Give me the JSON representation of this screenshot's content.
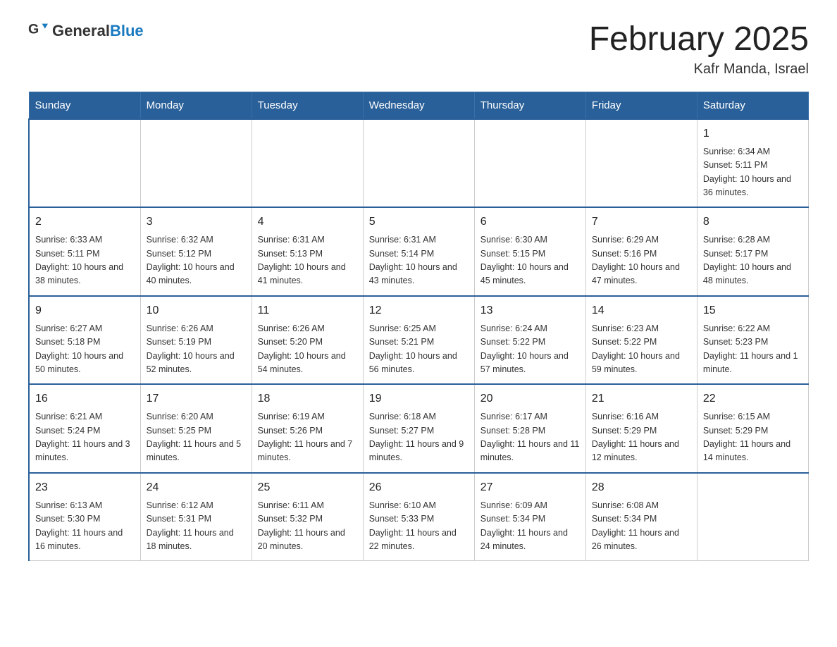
{
  "header": {
    "logo_general": "General",
    "logo_blue": "Blue",
    "month_title": "February 2025",
    "location": "Kafr Manda, Israel"
  },
  "days_of_week": [
    "Sunday",
    "Monday",
    "Tuesday",
    "Wednesday",
    "Thursday",
    "Friday",
    "Saturday"
  ],
  "weeks": [
    [
      {
        "day": "",
        "info": ""
      },
      {
        "day": "",
        "info": ""
      },
      {
        "day": "",
        "info": ""
      },
      {
        "day": "",
        "info": ""
      },
      {
        "day": "",
        "info": ""
      },
      {
        "day": "",
        "info": ""
      },
      {
        "day": "1",
        "info": "Sunrise: 6:34 AM\nSunset: 5:11 PM\nDaylight: 10 hours and 36 minutes."
      }
    ],
    [
      {
        "day": "2",
        "info": "Sunrise: 6:33 AM\nSunset: 5:11 PM\nDaylight: 10 hours and 38 minutes."
      },
      {
        "day": "3",
        "info": "Sunrise: 6:32 AM\nSunset: 5:12 PM\nDaylight: 10 hours and 40 minutes."
      },
      {
        "day": "4",
        "info": "Sunrise: 6:31 AM\nSunset: 5:13 PM\nDaylight: 10 hours and 41 minutes."
      },
      {
        "day": "5",
        "info": "Sunrise: 6:31 AM\nSunset: 5:14 PM\nDaylight: 10 hours and 43 minutes."
      },
      {
        "day": "6",
        "info": "Sunrise: 6:30 AM\nSunset: 5:15 PM\nDaylight: 10 hours and 45 minutes."
      },
      {
        "day": "7",
        "info": "Sunrise: 6:29 AM\nSunset: 5:16 PM\nDaylight: 10 hours and 47 minutes."
      },
      {
        "day": "8",
        "info": "Sunrise: 6:28 AM\nSunset: 5:17 PM\nDaylight: 10 hours and 48 minutes."
      }
    ],
    [
      {
        "day": "9",
        "info": "Sunrise: 6:27 AM\nSunset: 5:18 PM\nDaylight: 10 hours and 50 minutes."
      },
      {
        "day": "10",
        "info": "Sunrise: 6:26 AM\nSunset: 5:19 PM\nDaylight: 10 hours and 52 minutes."
      },
      {
        "day": "11",
        "info": "Sunrise: 6:26 AM\nSunset: 5:20 PM\nDaylight: 10 hours and 54 minutes."
      },
      {
        "day": "12",
        "info": "Sunrise: 6:25 AM\nSunset: 5:21 PM\nDaylight: 10 hours and 56 minutes."
      },
      {
        "day": "13",
        "info": "Sunrise: 6:24 AM\nSunset: 5:22 PM\nDaylight: 10 hours and 57 minutes."
      },
      {
        "day": "14",
        "info": "Sunrise: 6:23 AM\nSunset: 5:22 PM\nDaylight: 10 hours and 59 minutes."
      },
      {
        "day": "15",
        "info": "Sunrise: 6:22 AM\nSunset: 5:23 PM\nDaylight: 11 hours and 1 minute."
      }
    ],
    [
      {
        "day": "16",
        "info": "Sunrise: 6:21 AM\nSunset: 5:24 PM\nDaylight: 11 hours and 3 minutes."
      },
      {
        "day": "17",
        "info": "Sunrise: 6:20 AM\nSunset: 5:25 PM\nDaylight: 11 hours and 5 minutes."
      },
      {
        "day": "18",
        "info": "Sunrise: 6:19 AM\nSunset: 5:26 PM\nDaylight: 11 hours and 7 minutes."
      },
      {
        "day": "19",
        "info": "Sunrise: 6:18 AM\nSunset: 5:27 PM\nDaylight: 11 hours and 9 minutes."
      },
      {
        "day": "20",
        "info": "Sunrise: 6:17 AM\nSunset: 5:28 PM\nDaylight: 11 hours and 11 minutes."
      },
      {
        "day": "21",
        "info": "Sunrise: 6:16 AM\nSunset: 5:29 PM\nDaylight: 11 hours and 12 minutes."
      },
      {
        "day": "22",
        "info": "Sunrise: 6:15 AM\nSunset: 5:29 PM\nDaylight: 11 hours and 14 minutes."
      }
    ],
    [
      {
        "day": "23",
        "info": "Sunrise: 6:13 AM\nSunset: 5:30 PM\nDaylight: 11 hours and 16 minutes."
      },
      {
        "day": "24",
        "info": "Sunrise: 6:12 AM\nSunset: 5:31 PM\nDaylight: 11 hours and 18 minutes."
      },
      {
        "day": "25",
        "info": "Sunrise: 6:11 AM\nSunset: 5:32 PM\nDaylight: 11 hours and 20 minutes."
      },
      {
        "day": "26",
        "info": "Sunrise: 6:10 AM\nSunset: 5:33 PM\nDaylight: 11 hours and 22 minutes."
      },
      {
        "day": "27",
        "info": "Sunrise: 6:09 AM\nSunset: 5:34 PM\nDaylight: 11 hours and 24 minutes."
      },
      {
        "day": "28",
        "info": "Sunrise: 6:08 AM\nSunset: 5:34 PM\nDaylight: 11 hours and 26 minutes."
      },
      {
        "day": "",
        "info": ""
      }
    ]
  ]
}
